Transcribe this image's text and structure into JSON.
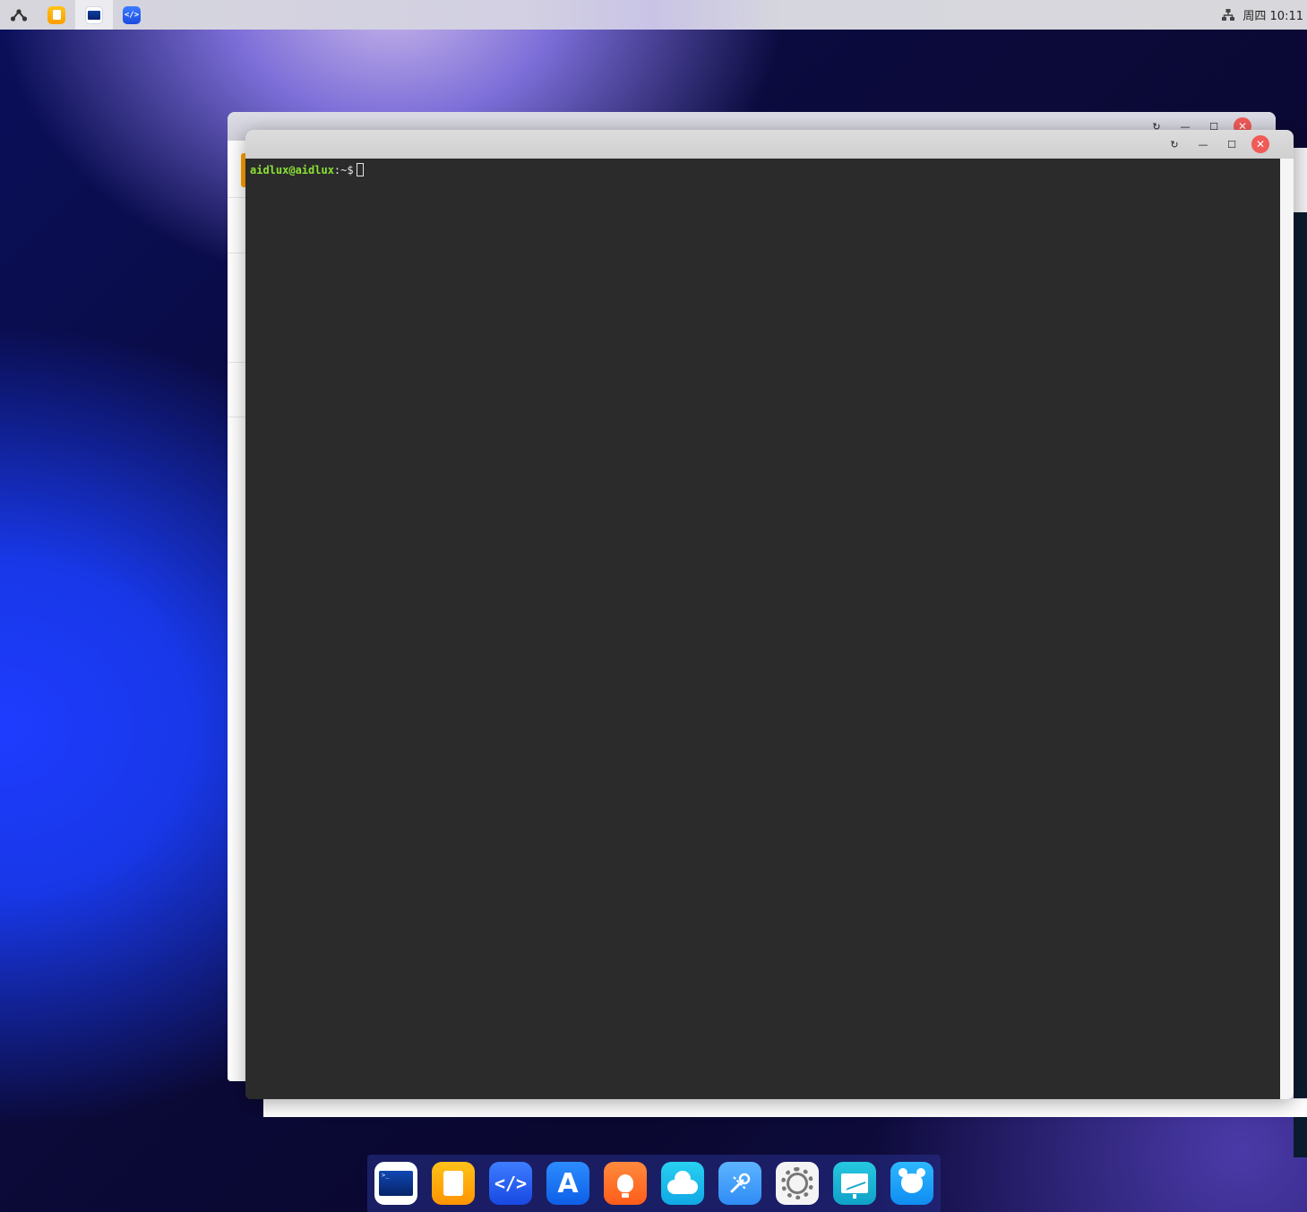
{
  "topbar": {
    "apps": [
      {
        "name": "menu-icon"
      },
      {
        "name": "files-icon"
      },
      {
        "name": "terminal-icon"
      },
      {
        "name": "code-editor-icon"
      }
    ],
    "tray": {
      "network_icon": "network-icon",
      "clock": "周四 10:11"
    }
  },
  "windows": {
    "background_window": {
      "controls": [
        "refresh",
        "minimize",
        "maximize",
        "close"
      ]
    },
    "terminal": {
      "controls": [
        "refresh",
        "minimize",
        "maximize",
        "close"
      ],
      "prompt_user": "aidlux@aidlux",
      "prompt_path": ":~$"
    }
  },
  "dock": {
    "items": [
      {
        "name": "terminal"
      },
      {
        "name": "files"
      },
      {
        "name": "code-editor",
        "glyph": "</>"
      },
      {
        "name": "app-store",
        "glyph": "A"
      },
      {
        "name": "idea-bulb"
      },
      {
        "name": "cloud"
      },
      {
        "name": "tools"
      },
      {
        "name": "settings"
      },
      {
        "name": "system-monitor"
      },
      {
        "name": "bear-app"
      }
    ]
  },
  "colors": {
    "prompt_green": "#8ae234",
    "terminal_bg": "#2b2b2b",
    "close_red": "#f05a57"
  }
}
